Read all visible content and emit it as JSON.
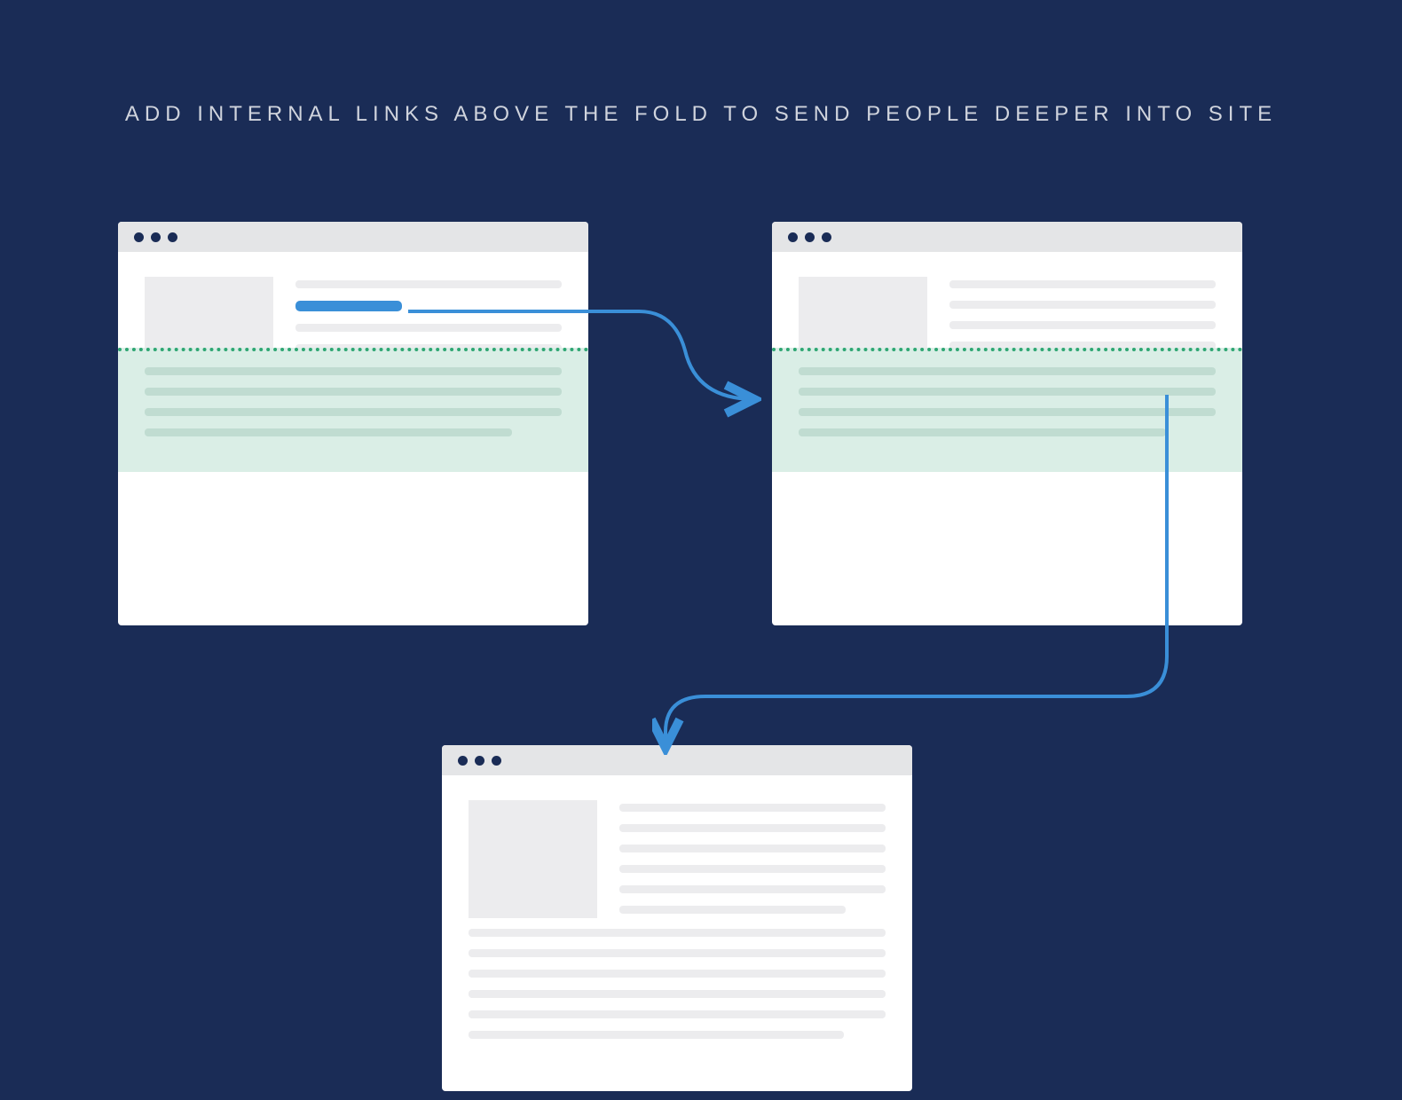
{
  "title": "ADD INTERNAL LINKS ABOVE THE FOLD TO SEND PEOPLE DEEPER INTO SITE",
  "colors": {
    "background": "#1a2c56",
    "linkHighlight": "#3a8fd8",
    "foldOverlay": "#daeee6",
    "foldBorder": "#2fa673",
    "textPlaceholder": "#ececee",
    "chromeBar": "#e4e5e7"
  },
  "diagram": {
    "concept": "Internal linking above the fold",
    "windows": [
      {
        "id": "source-page-1",
        "hasFold": true,
        "linkPosition": "second-line"
      },
      {
        "id": "target-page-2",
        "hasFold": true,
        "linkPosition": "last-line-right"
      },
      {
        "id": "target-page-3",
        "hasFold": false,
        "linkPosition": "none"
      }
    ],
    "flows": [
      {
        "from": "source-page-1",
        "to": "target-page-2"
      },
      {
        "from": "target-page-2",
        "to": "target-page-3"
      }
    ]
  }
}
